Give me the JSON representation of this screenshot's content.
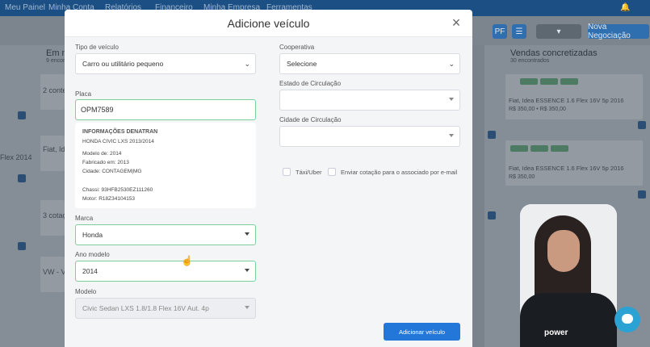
{
  "background": {
    "nav_items": [
      "Meu Painel",
      "Minha Conta",
      "Relatórios",
      "Financeiro",
      "Minha Empresa",
      "Ferramentas"
    ],
    "toolbar": {
      "pf_label": "PF",
      "new_negotiation_label": "Nova Negociação"
    },
    "columns": {
      "in_negotiation": {
        "title": "Em ne",
        "sub": "9 encor"
      },
      "sales": {
        "title": "Vendas concretizadas",
        "sub": "30 encontrados"
      }
    },
    "cards_right": [
      {
        "line1": "Fiat, Idea ESSENCE 1.6 Flex 16V 5p 2016",
        "line2": "R$ 350,00 • R$ 350,00"
      },
      {
        "line1": "Fiat, Idea ESSENCE 1.6 Flex 16V 5p 2016",
        "line2": "R$ 350,00"
      }
    ],
    "left_snippets": [
      "2 conte",
      "Fiat, Ide",
      "Flex 2014",
      "3 cotaç",
      "VW - Vo"
    ]
  },
  "modal": {
    "title": "Adicione veículo",
    "fields": {
      "vehicle_type": {
        "label": "Tipo de veículo",
        "value": "Carro ou utilitário pequeno"
      },
      "plate": {
        "label": "Placa",
        "value": "OPM7589"
      },
      "brand": {
        "label": "Marca",
        "value": "Honda"
      },
      "model_year": {
        "label": "Ano modelo",
        "value": "2014"
      },
      "model": {
        "label": "Modelo",
        "value": "Civic Sedan LXS 1.8/1.8 Flex 16V Aut. 4p"
      },
      "cooperative": {
        "label": "Cooperativa",
        "value": "Selecione"
      },
      "circulation_state": {
        "label": "Estado de Circulação",
        "value": ""
      },
      "circulation_city": {
        "label": "Cidade de Circulação",
        "value": ""
      }
    },
    "denatran": {
      "title": "INFORMAÇÕES DENATRAN",
      "vehicle": "HONDA CIVIC LXS 2013/2014",
      "model_of": "Modelo de: 2014",
      "manufactured": "Fabricado em: 2013",
      "city": "Cidade: CONTAGEM|MG",
      "chassis": "Chassi: 93HFB2530EZ111260",
      "motor": "Motor: R18Z34104153"
    },
    "checkboxes": {
      "taxi": "Táxi/Uber",
      "send_quote": "Enviar cotação para o associado por e-mail"
    },
    "submit_label": "Adicionar veículo"
  },
  "webcam": {
    "logo_text": "power"
  }
}
